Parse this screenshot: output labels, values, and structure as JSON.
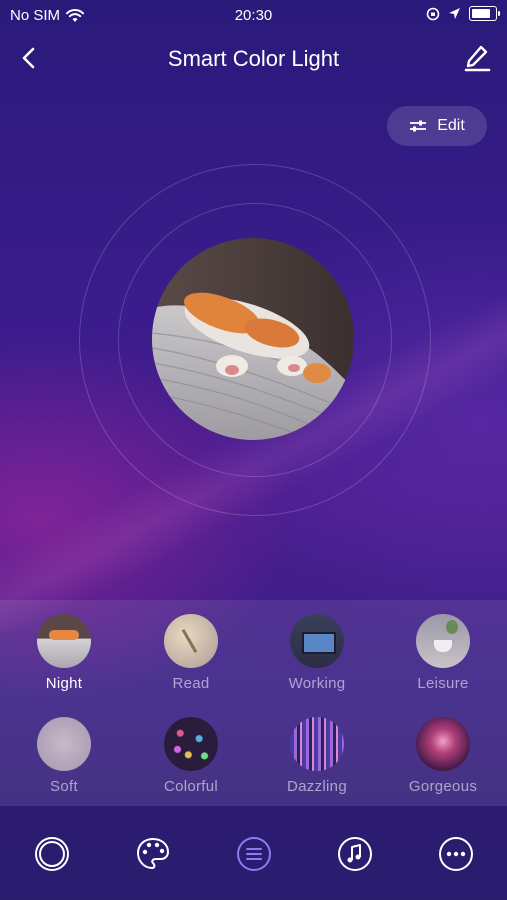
{
  "status_bar": {
    "carrier": "No SIM",
    "time": "20:30"
  },
  "header": {
    "title": "Smart Color Light",
    "back_icon": "chevron-left-icon",
    "edit_icon": "pencil-icon"
  },
  "edit_button": {
    "label": "Edit",
    "icon": "sliders-icon"
  },
  "current_scene_image": "cat-sleeping-photo",
  "scenes": [
    {
      "label": "Night",
      "active": true
    },
    {
      "label": "Read",
      "active": false
    },
    {
      "label": "Working",
      "active": false
    },
    {
      "label": "Leisure",
      "active": false
    },
    {
      "label": "Soft",
      "active": false
    },
    {
      "label": "Colorful",
      "active": false
    },
    {
      "label": "Dazzling",
      "active": false
    },
    {
      "label": "Gorgeous",
      "active": false
    }
  ],
  "bottom_nav": [
    {
      "icon": "white-light-icon",
      "active": false
    },
    {
      "icon": "palette-icon",
      "active": false
    },
    {
      "icon": "scene-list-icon",
      "active": true
    },
    {
      "icon": "music-icon",
      "active": false
    },
    {
      "icon": "more-icon",
      "active": false
    }
  ],
  "colors": {
    "background_top": "#2a1a7a",
    "background_mid": "#4a1d8e",
    "nav_active": "#8a7cf0"
  }
}
